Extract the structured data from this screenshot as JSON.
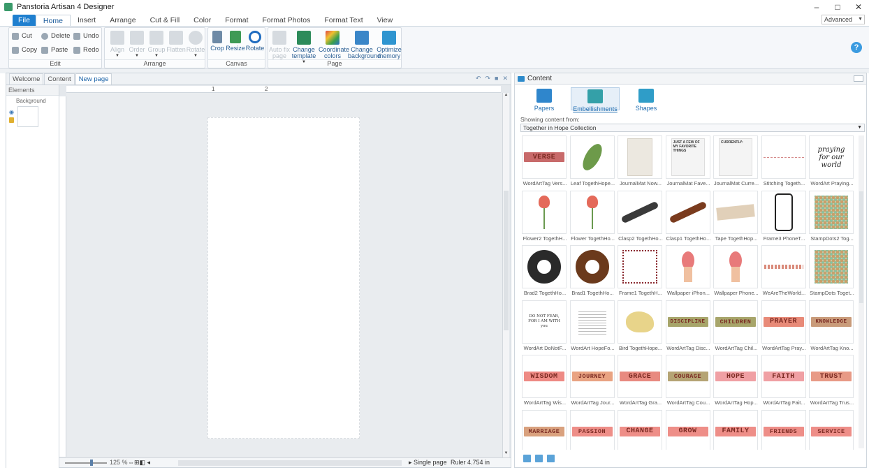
{
  "window": {
    "title": "Panstoria Artisan 4 Designer",
    "minimize": "–",
    "restore": "□",
    "close": "✕"
  },
  "menu": {
    "tabs": [
      "File",
      "Home",
      "Insert",
      "Arrange",
      "Cut & Fill",
      "Color",
      "Format",
      "Format Photos",
      "Format Text",
      "View"
    ],
    "active": "Home",
    "mode_select": "Advanced"
  },
  "ribbon": {
    "edit": {
      "label": "Edit",
      "cut": "Cut",
      "delete": "Delete",
      "undo": "Undo",
      "copy": "Copy",
      "paste": "Paste",
      "redo": "Redo"
    },
    "arrange": {
      "label": "Arrange",
      "align": "Align",
      "order": "Order",
      "group": "Group",
      "flatten": "Flatten",
      "rotate": "Rotate"
    },
    "canvas": {
      "label": "Canvas",
      "crop": "Crop",
      "resize": "Resize",
      "rotate": "Rotate"
    },
    "page": {
      "label": "Page",
      "autofix": "Auto fix page",
      "change_template": "Change template",
      "coordinate_colors": "Coordinate colors",
      "change_background": "Change background",
      "optimize_memory": "Optimize memory"
    },
    "help": "?"
  },
  "editor": {
    "tabs": [
      "Welcome",
      "Content",
      "New page"
    ],
    "active_tab": "New page",
    "elements_label": "Elements",
    "background_label": "Background",
    "ruler_marks": [
      "1",
      "2"
    ],
    "zoom": "125 %",
    "page_mode": "Single page",
    "ruler_readout": "Ruler 4.754 in"
  },
  "content_panel": {
    "title": "Content",
    "types": [
      "Papers",
      "Embellishments",
      "Shapes"
    ],
    "selected_type": "Embellishments",
    "showing_label": "Showing content from:",
    "collection": "Together in Hope Collection",
    "items": [
      {
        "cap": "WordArtTag Vers...",
        "kind": "tag",
        "text": "VERSE",
        "color": "#c86a6a"
      },
      {
        "cap": "Leaf TogethHope...",
        "kind": "leaf"
      },
      {
        "cap": "JournalMat Now...",
        "kind": "paper"
      },
      {
        "cap": "JournalMat Fave...",
        "kind": "list",
        "text": "JUST A FEW OF MY FAVORITE THINGS"
      },
      {
        "cap": "JournalMat Curre...",
        "kind": "list",
        "text": "CURRENTLY:"
      },
      {
        "cap": "Stitching Togeth...",
        "kind": "stitch"
      },
      {
        "cap": "WordArt Praying...",
        "kind": "script",
        "text": "praying for our world"
      },
      {
        "cap": "Flower2 TogethH...",
        "kind": "flower2"
      },
      {
        "cap": "Flower TogethHo...",
        "kind": "flower"
      },
      {
        "cap": "Clasp2 TogethHo...",
        "kind": "clasp",
        "color": "#3a3a3a"
      },
      {
        "cap": "Clasp1 TogethHo...",
        "kind": "clasp",
        "color": "#7a3b1e"
      },
      {
        "cap": "Tape TogethHop...",
        "kind": "tape"
      },
      {
        "cap": "Frame3 PhoneT...",
        "kind": "phone"
      },
      {
        "cap": "StampDots2 Tog...",
        "kind": "dots"
      },
      {
        "cap": "Brad2 TogethHo...",
        "kind": "brad",
        "color": "#2a2a2a"
      },
      {
        "cap": "Brad1 TogethHo...",
        "kind": "brad",
        "color": "#6b3a1c"
      },
      {
        "cap": "Frame1 TogethH...",
        "kind": "frame"
      },
      {
        "cap": "Wallpaper iPhon...",
        "kind": "wall"
      },
      {
        "cap": "Wallpaper Phone...",
        "kind": "wall"
      },
      {
        "cap": "WeAreTheWorld...",
        "kind": "border"
      },
      {
        "cap": "StampDots Toget...",
        "kind": "dots"
      },
      {
        "cap": "WordArt DoNotF...",
        "kind": "text",
        "text": "DO NOT FEAR, FOR I AM WITH you"
      },
      {
        "cap": "WordArt HopeFo...",
        "kind": "small"
      },
      {
        "cap": "Bird TogethHope...",
        "kind": "bird"
      },
      {
        "cap": "WordArtTag Disc...",
        "kind": "tag",
        "text": "DISCIPLINE",
        "color": "#a7a56a"
      },
      {
        "cap": "WordArtTag Chil...",
        "kind": "tag",
        "text": "CHILDREN",
        "color": "#a7a56a"
      },
      {
        "cap": "WordArtTag Pray...",
        "kind": "tag",
        "text": "PRAYER",
        "color": "#e88a78"
      },
      {
        "cap": "WordArtTag Kno...",
        "kind": "tag",
        "text": "KNOWLEDGE",
        "color": "#c99b7a"
      },
      {
        "cap": "WordArtTag Wis...",
        "kind": "tag",
        "text": "WISDOM",
        "color": "#ee8a84"
      },
      {
        "cap": "WordArtTag Jour...",
        "kind": "tag",
        "text": "JOURNEY",
        "color": "#e9a382"
      },
      {
        "cap": "WordArtTag Gra...",
        "kind": "tag",
        "text": "GRACE",
        "color": "#e88a80"
      },
      {
        "cap": "WordArtTag Cou...",
        "kind": "tag",
        "text": "COURAGE",
        "color": "#b5a474"
      },
      {
        "cap": "WordArtTag Hop...",
        "kind": "tag",
        "text": "HOPE",
        "color": "#f0a0a4"
      },
      {
        "cap": "WordArtTag Fait...",
        "kind": "tag",
        "text": "FAITH",
        "color": "#f0a0a4"
      },
      {
        "cap": "WordArtTag Trus...",
        "kind": "tag",
        "text": "TRUST",
        "color": "#e89a86"
      },
      {
        "cap": "",
        "kind": "tag",
        "text": "MARRIAGE",
        "color": "#d9a17e"
      },
      {
        "cap": "",
        "kind": "tag",
        "text": "PASSION",
        "color": "#ee8e88"
      },
      {
        "cap": "",
        "kind": "tag",
        "text": "CHANGE",
        "color": "#ee8e88"
      },
      {
        "cap": "",
        "kind": "tag",
        "text": "GROW",
        "color": "#ee8e88"
      },
      {
        "cap": "",
        "kind": "tag",
        "text": "FAMILY",
        "color": "#ee8e88"
      },
      {
        "cap": "",
        "kind": "tag",
        "text": "FRIENDS",
        "color": "#ee8e88"
      },
      {
        "cap": "",
        "kind": "tag",
        "text": "SERVICE",
        "color": "#ee8e88"
      }
    ]
  },
  "colors": {
    "accent": "#1f7fcf",
    "ribbon_bg": "#f5f7fa"
  }
}
